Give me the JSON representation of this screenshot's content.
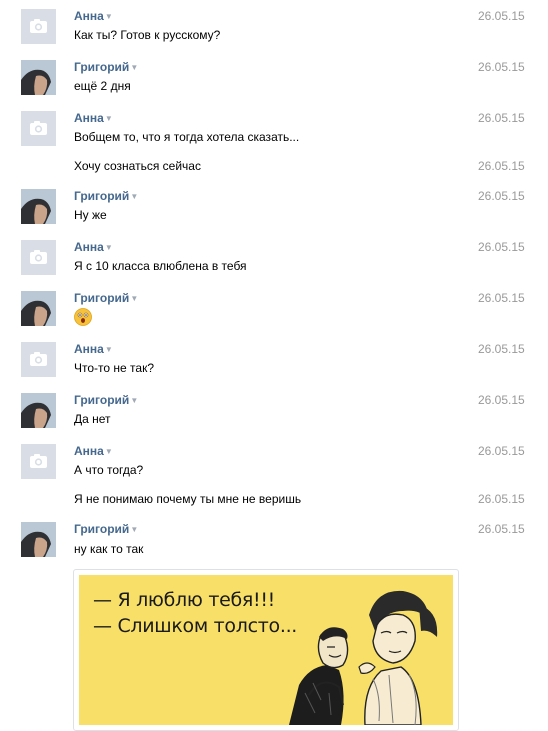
{
  "messages": [
    {
      "author": "Анна",
      "text": "Как ты? Готов к русскому?",
      "date": "26.05.15"
    },
    {
      "author": "Григорий",
      "text": "ещё 2 дня",
      "date": "26.05.15"
    },
    {
      "author": "Анна",
      "text": "Вобщем то, что я тогда хотела сказать...",
      "date": "26.05.15"
    },
    {
      "author": "",
      "text": "Хочу сознаться сейчас",
      "date": "26.05.15"
    },
    {
      "author": "Григорий",
      "text": "Ну же",
      "date": "26.05.15"
    },
    {
      "author": "Анна",
      "text": "Я с 10 класса влюблена в тебя",
      "date": "26.05.15"
    },
    {
      "author": "Григорий",
      "text": "",
      "date": "26.05.15",
      "emoji": "shocked-face-emoji"
    },
    {
      "author": "Анна",
      "text": "Что-то не так?",
      "date": "26.05.15"
    },
    {
      "author": "Григорий",
      "text": "Да нет",
      "date": "26.05.15"
    },
    {
      "author": "Анна",
      "text": "А что тогда?",
      "date": "26.05.15"
    },
    {
      "author": "",
      "text": "Я не понимаю почему ты мне не веришь",
      "date": "26.05.15"
    },
    {
      "author": "Григорий",
      "text": "ну как то так",
      "date": "26.05.15"
    }
  ],
  "attachment": {
    "line1": "— Я люблю тебя!!!",
    "line2": "— Слишком толсто..."
  },
  "colors": {
    "author": "#45688e",
    "date": "#999999",
    "meme_bg": "#f8e068"
  },
  "icons": {
    "anna_avatar": "camera-icon",
    "grigoriy_avatar": "profile-photo",
    "author_menu": "triangle-down-icon"
  }
}
